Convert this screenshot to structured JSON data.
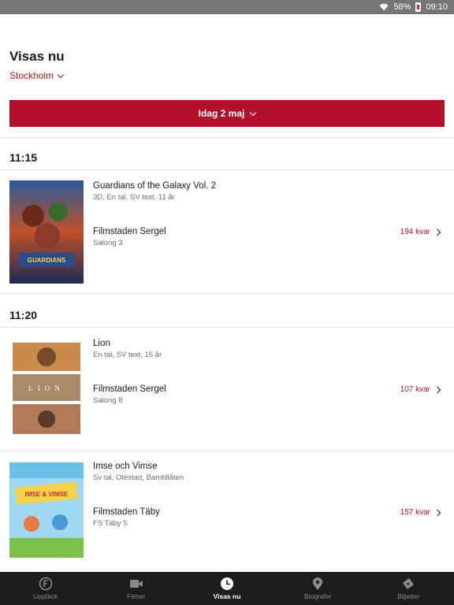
{
  "status_bar": {
    "battery": "58%",
    "time": "09:10"
  },
  "header": {
    "title": "Visas nu",
    "city": "Stockholm"
  },
  "date_selector": {
    "label": "Idag 2 maj"
  },
  "groups": [
    {
      "time": "11:15",
      "movies": [
        {
          "title": "Guardians of the Galaxy Vol. 2",
          "meta": "3D, En tal, SV text, 11 år",
          "cinema": "Filmstaden Sergel",
          "salon": "Salong 3",
          "seats": "194 kvar"
        }
      ]
    },
    {
      "time": "11:20",
      "movies": [
        {
          "title": "Lion",
          "meta": "En tal, SV text, 15 år",
          "cinema": "Filmstaden Sergel",
          "salon": "Salong 8",
          "seats": "107 kvar"
        },
        {
          "title": "Imse och Vimse",
          "meta": "Sv tal, Otextad, Barntillåten",
          "cinema": "Filmstaden Täby",
          "salon": "FS Täby 5",
          "seats": "157 kvar"
        }
      ]
    }
  ],
  "nav": [
    {
      "label": "Upptäck",
      "icon": "discover-f-icon"
    },
    {
      "label": "Filmer",
      "icon": "video-camera-icon"
    },
    {
      "label": "Visas nu",
      "icon": "clock-icon"
    },
    {
      "label": "Biografer",
      "icon": "location-pin-icon"
    },
    {
      "label": "Biljetter",
      "icon": "ticket-icon"
    }
  ],
  "colors": {
    "accent": "#b0102a",
    "statusbar": "#757575",
    "nav_bg": "#1c1c1c"
  }
}
